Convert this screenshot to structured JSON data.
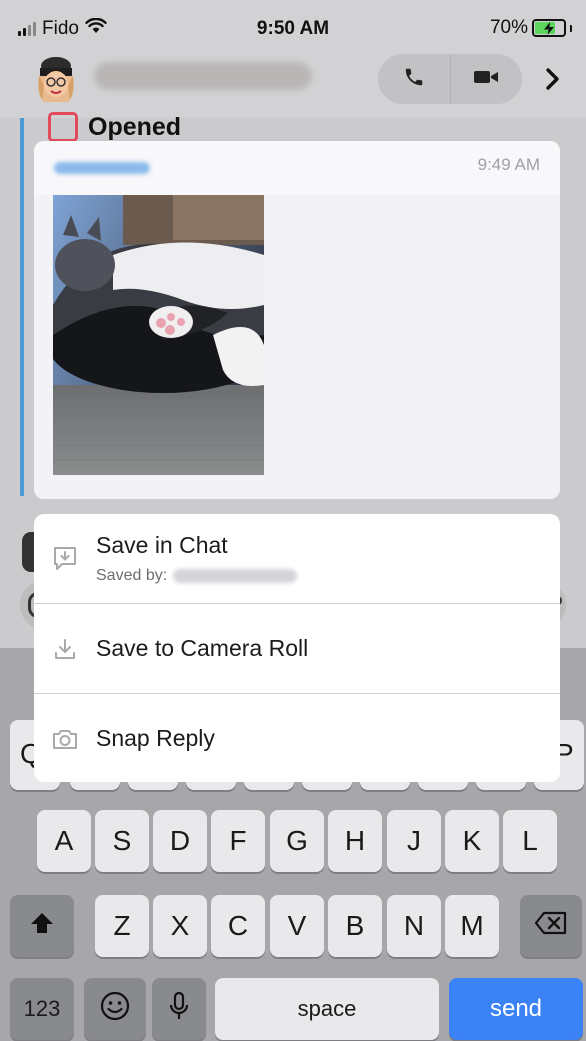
{
  "status_bar": {
    "carrier": "Fido",
    "time": "9:50 AM",
    "battery_percent": "70%",
    "battery_level": 0.7,
    "icons": [
      "signal-icon",
      "wifi-icon",
      "battery-charging-icon"
    ]
  },
  "chat_header": {
    "icons": [
      "bitmoji-avatar",
      "phone-icon",
      "video-camera-icon",
      "chevron-right-icon"
    ]
  },
  "chat": {
    "opened_label": "Opened"
  },
  "snap": {
    "time": "9:49 AM"
  },
  "context_menu": {
    "items": [
      {
        "label": "Save in Chat",
        "sublabel": "Saved by:",
        "icon": "save-in-chat-icon"
      },
      {
        "label": "Save to Camera Roll",
        "icon": "download-icon"
      },
      {
        "label": "Snap Reply",
        "icon": "camera-icon"
      }
    ]
  },
  "keyboard": {
    "row1_visible": [
      "Q",
      "P"
    ],
    "row2": [
      "A",
      "S",
      "D",
      "F",
      "G",
      "H",
      "J",
      "K",
      "L"
    ],
    "row3": [
      "Z",
      "X",
      "C",
      "V",
      "B",
      "N",
      "M"
    ],
    "numbers_key": "123",
    "space_key": "space",
    "send_key": "send",
    "icons": [
      "shift-icon",
      "backspace-icon",
      "emoji-icon",
      "microphone-icon"
    ]
  },
  "colors": {
    "accent_blue": "#3b82f6",
    "opened_red": "#e04a5a",
    "chat_accent": "#4a9bd8"
  }
}
